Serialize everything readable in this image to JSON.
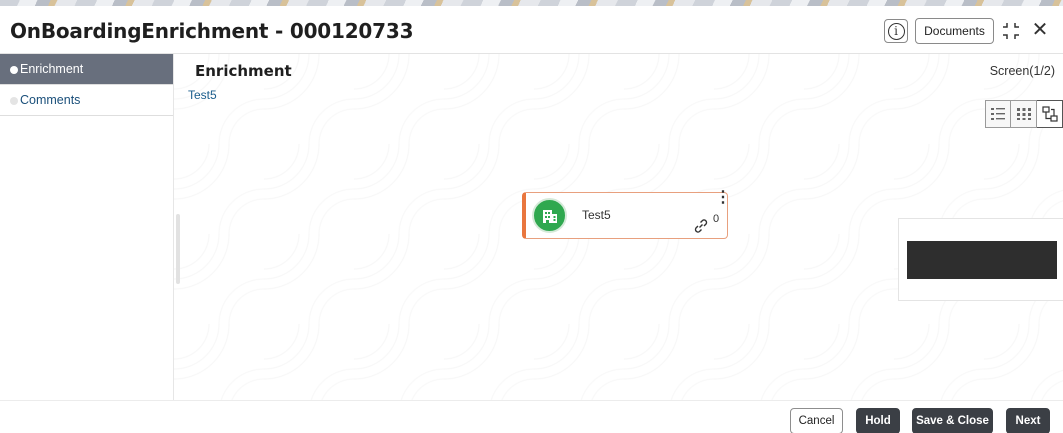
{
  "header": {
    "title": "OnBoardingEnrichment - 000120733",
    "documents_label": "Documents",
    "info_icon": "info-icon",
    "info_glyph": "i",
    "shrink_icon": "shrink-icon",
    "close_icon": "close-icon",
    "close_glyph": "✕"
  },
  "sidebar": {
    "items": [
      {
        "label": "Enrichment",
        "active": true
      },
      {
        "label": "Comments",
        "active": false
      }
    ]
  },
  "main": {
    "section_title": "Enrichment",
    "screen_indicator": "Screen(1/2)",
    "subtitle": "Test5",
    "view_toggles": [
      "list-view-icon",
      "grid-view-icon",
      "tree-view-icon"
    ],
    "active_view": "tree-view-icon",
    "node": {
      "label": "Test5",
      "link_count": "0",
      "menu_glyph": "⋮",
      "avatar_icon": "building-icon",
      "accent_color": "#e9763e",
      "avatar_color": "#2fa84f"
    }
  },
  "footer": {
    "cancel_label": "Cancel",
    "hold_label": "Hold",
    "save_close_label": "Save & Close",
    "next_label": "Next"
  }
}
